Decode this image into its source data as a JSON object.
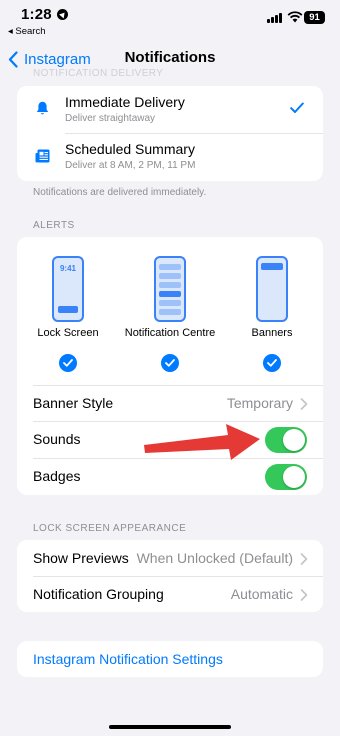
{
  "status": {
    "time": "1:28",
    "back_app": "◂ Search",
    "battery": "91"
  },
  "nav": {
    "back_label": "Instagram",
    "title": "Notifications"
  },
  "delivery": {
    "faded_header": "NOTIFICATION DELIVERY",
    "immediate": {
      "title": "Immediate Delivery",
      "subtitle": "Deliver straightaway",
      "selected": true
    },
    "scheduled": {
      "title": "Scheduled Summary",
      "subtitle": "Deliver at 8 AM, 2 PM, 11 PM"
    },
    "footnote": "Notifications are delivered immediately."
  },
  "alerts": {
    "header": "ALERTS",
    "lock_screen": {
      "label": "Lock Screen",
      "time": "9:41",
      "checked": true
    },
    "notification_centre": {
      "label": "Notification Centre",
      "checked": true
    },
    "banners": {
      "label": "Banners",
      "checked": true
    },
    "banner_style": {
      "label": "Banner Style",
      "value": "Temporary"
    },
    "sounds": {
      "label": "Sounds",
      "on": true
    },
    "badges": {
      "label": "Badges",
      "on": true
    }
  },
  "lock_screen_appearance": {
    "header": "LOCK SCREEN APPEARANCE",
    "show_previews": {
      "label": "Show Previews",
      "value": "When Unlocked (Default)"
    },
    "grouping": {
      "label": "Notification Grouping",
      "value": "Automatic"
    }
  },
  "app_settings_link": "Instagram Notification Settings",
  "colors": {
    "accent": "#007aff",
    "toggle_on": "#34c759",
    "annotation_arrow": "#e53935"
  },
  "icons": [
    "location-icon",
    "signal-icon",
    "wifi-icon",
    "battery-icon",
    "back-chevron-icon",
    "bell-icon",
    "newspaper-icon",
    "checkmark-icon",
    "chevron-right-icon",
    "annotation-arrow"
  ]
}
